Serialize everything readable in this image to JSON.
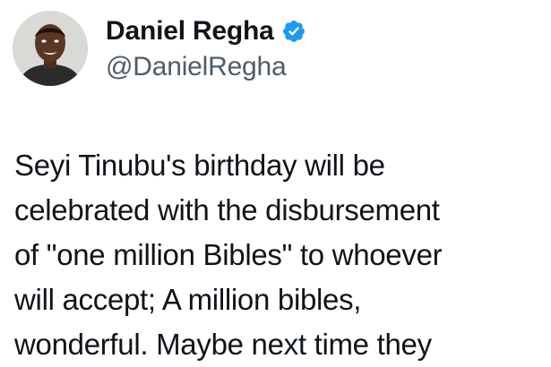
{
  "author": {
    "display_name": "Daniel Regha",
    "handle": "@DanielRegha",
    "verified": true,
    "verified_badge_color": "#1d9bf0"
  },
  "tweet": {
    "lines": [
      "Seyi Tinubu's birthday will be",
      "celebrated with the disbursement",
      "of \"one million Bibles\" to whoever",
      "will accept; A million bibles,",
      "wonderful. Maybe next time they"
    ]
  },
  "icons": {
    "avatar": "profile-photo",
    "badge": "verified-badge-icon"
  }
}
